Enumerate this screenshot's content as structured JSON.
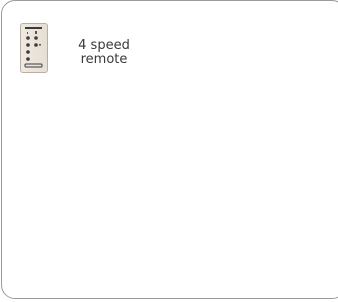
{
  "product": {
    "icon": "fan-remote-icon",
    "label_line1": "4 speed",
    "label_line2": "remote"
  }
}
